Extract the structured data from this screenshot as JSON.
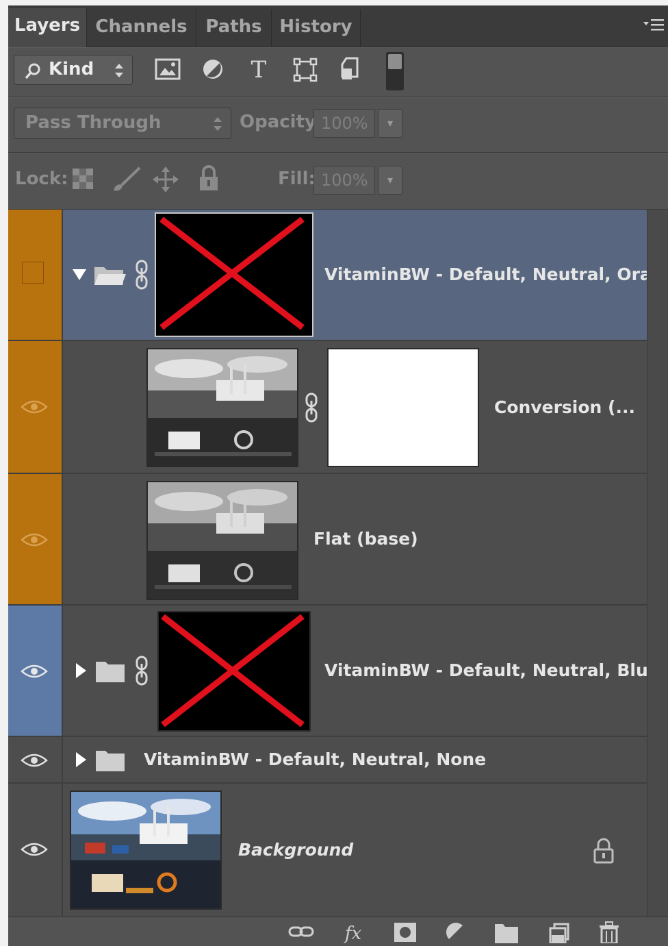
{
  "tabs": [
    {
      "label": "Layers"
    },
    {
      "label": "Channels"
    },
    {
      "label": "Paths"
    },
    {
      "label": "History"
    }
  ],
  "filter": {
    "kind_label": "Kind",
    "icons": [
      "image-filter-icon",
      "adjustment-filter-icon",
      "type-filter-icon",
      "shape-filter-icon",
      "smart-object-filter-icon",
      "filter-toggle-switch"
    ]
  },
  "blend": {
    "mode": "Pass Through",
    "opacity_label": "Opacity:",
    "opacity_value": "100%"
  },
  "lock": {
    "label": "Lock:",
    "fill_label": "Fill:",
    "fill_value": "100%"
  },
  "layers": [
    {
      "name": "VitaminBW - Default, Neutral, Ora...",
      "type": "group",
      "expanded": true,
      "visible": false,
      "color": "#b8720e",
      "selected": true
    },
    {
      "name": "Conversion (...",
      "type": "pixel-with-mask",
      "visible": true,
      "color": "#b8720e"
    },
    {
      "name": "Flat (base)",
      "type": "pixel",
      "visible": true,
      "color": "#b8720e"
    },
    {
      "name": "VitaminBW - Default, Neutral, Blue",
      "type": "group",
      "expanded": false,
      "visible": true,
      "color": "#5d7aa6"
    },
    {
      "name": "VitaminBW - Default, Neutral, None",
      "type": "group",
      "expanded": false,
      "visible": true,
      "color": "none"
    },
    {
      "name": "Background",
      "type": "background",
      "visible": true,
      "locked": true
    }
  ],
  "colors": {
    "panel": "#4a4a4a",
    "selected_row": "#58677f",
    "orange_label": "#b8720e",
    "blue_label": "#5d7aa6",
    "missing_thumb_x": "#e0101c"
  },
  "bottom_icons": [
    "link-layers-icon",
    "layer-style-fx-icon",
    "add-mask-icon",
    "new-adjustment-layer-icon",
    "new-group-icon",
    "new-layer-icon",
    "delete-layer-icon"
  ]
}
